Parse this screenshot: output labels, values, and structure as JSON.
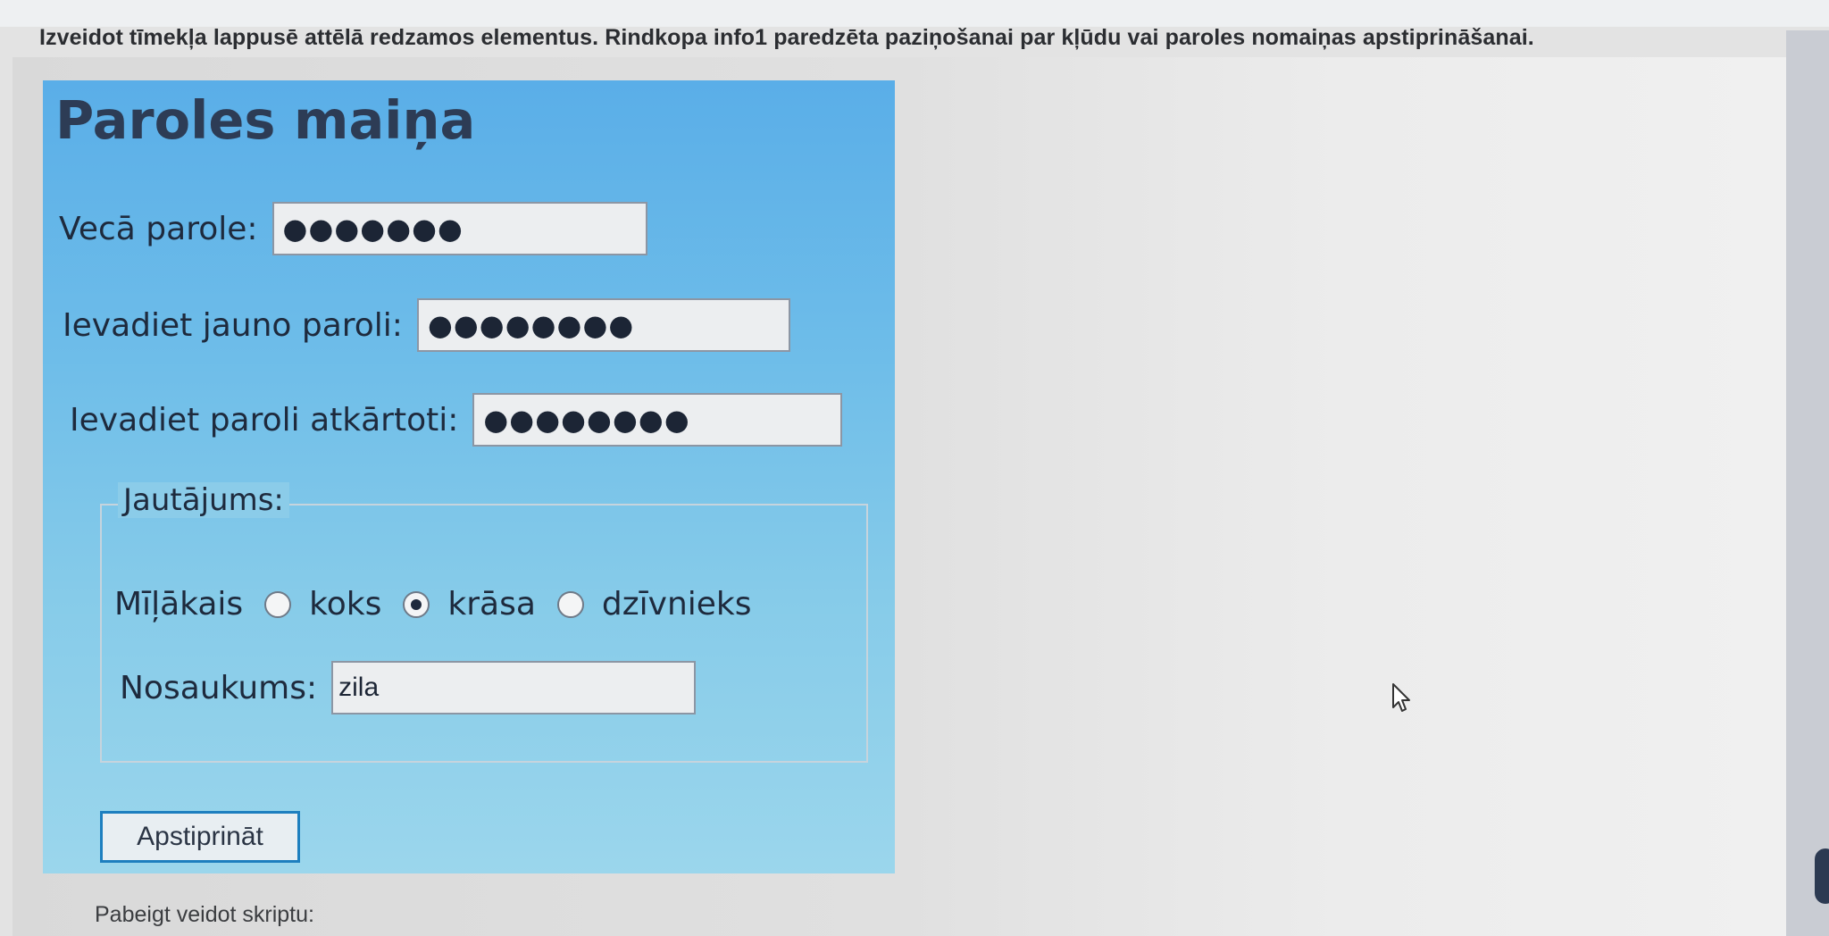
{
  "instruction": "Izveidot tīmekļa lappusē attēlā redzamos elementus. Rindkopa info1 paredzēta paziņošanai par kļūdu vai paroles nomaiņas apstiprināšanai.",
  "form": {
    "title": "Paroles maiņa",
    "old_password": {
      "label": "Vecā parole:",
      "value": "●●●●●●●"
    },
    "new_password": {
      "label": "Ievadiet jauno paroli:",
      "value": "●●●●●●●●"
    },
    "repeat_password": {
      "label": "Ievadiet paroli atkārtoti:",
      "value": "●●●●●●●●"
    },
    "question": {
      "legend": "Jautājums:",
      "prompt": "Mīļākais",
      "options": [
        {
          "label": "koks",
          "checked": false
        },
        {
          "label": "krāsa",
          "checked": true
        },
        {
          "label": "dzīvnieks",
          "checked": false
        }
      ],
      "name_label": "Nosaukums:",
      "name_value": "zila"
    },
    "submit_label": "Apstiprināt"
  },
  "footer": "Pabeigt veidot skriptu:",
  "colors": {
    "panel_top": "#5aaee8",
    "panel_bottom": "#9bd6ec",
    "button_border": "#1d7fbf",
    "title_text": "#2d3c55"
  }
}
